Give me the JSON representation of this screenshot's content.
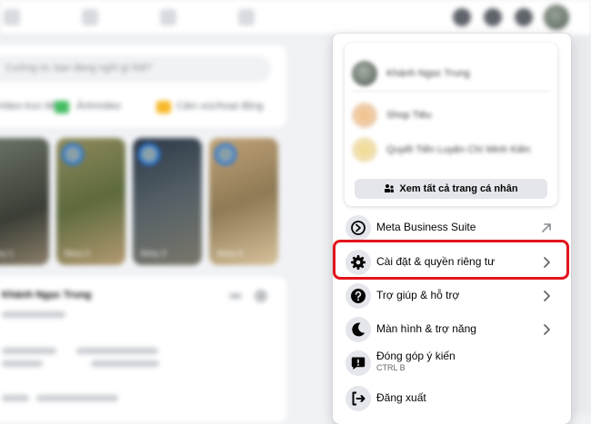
{
  "background": {
    "composer_placeholder": "Cường ơi, bạn đang nghĩ gì thế?",
    "chips": [
      "Video trực tiếp",
      "Ảnh/video",
      "Cảm xúc/hoạt động"
    ],
    "stories": [
      "Story 1",
      "Story 2",
      "Story 3",
      "Story 4"
    ],
    "post_author": "Khánh Ngọc Trung"
  },
  "menu": {
    "profile_name": "Khánh Ngọc Trung",
    "page_name": "Shop Tiêu",
    "page_name_2": "Quyết Tiến Luyện Chí Minh Kiên",
    "see_all_label": "Xem tất cả trang cá nhân",
    "items": [
      {
        "label": "Meta Business Suite",
        "icon": "meta-business-suite-icon",
        "trailing": "external-link-icon"
      },
      {
        "label": "Cài đặt & quyền riêng tư",
        "icon": "gear-icon",
        "trailing": "chevron-right-icon"
      },
      {
        "label": "Trợ giúp & hỗ trợ",
        "icon": "question-icon",
        "trailing": "chevron-right-icon"
      },
      {
        "label": "Màn hình & trợ năng",
        "icon": "moon-icon",
        "trailing": "chevron-right-icon"
      },
      {
        "label": "Đóng góp ý kiến",
        "sublabel": "CTRL B",
        "icon": "feedback-icon"
      },
      {
        "label": "Đăng xuất",
        "icon": "logout-icon"
      }
    ]
  },
  "colors": {
    "highlight": "#e3141c",
    "menu_bg": "#ffffff",
    "icon_bg": "#e4e6eb",
    "page_bg": "#f0f2f5"
  }
}
